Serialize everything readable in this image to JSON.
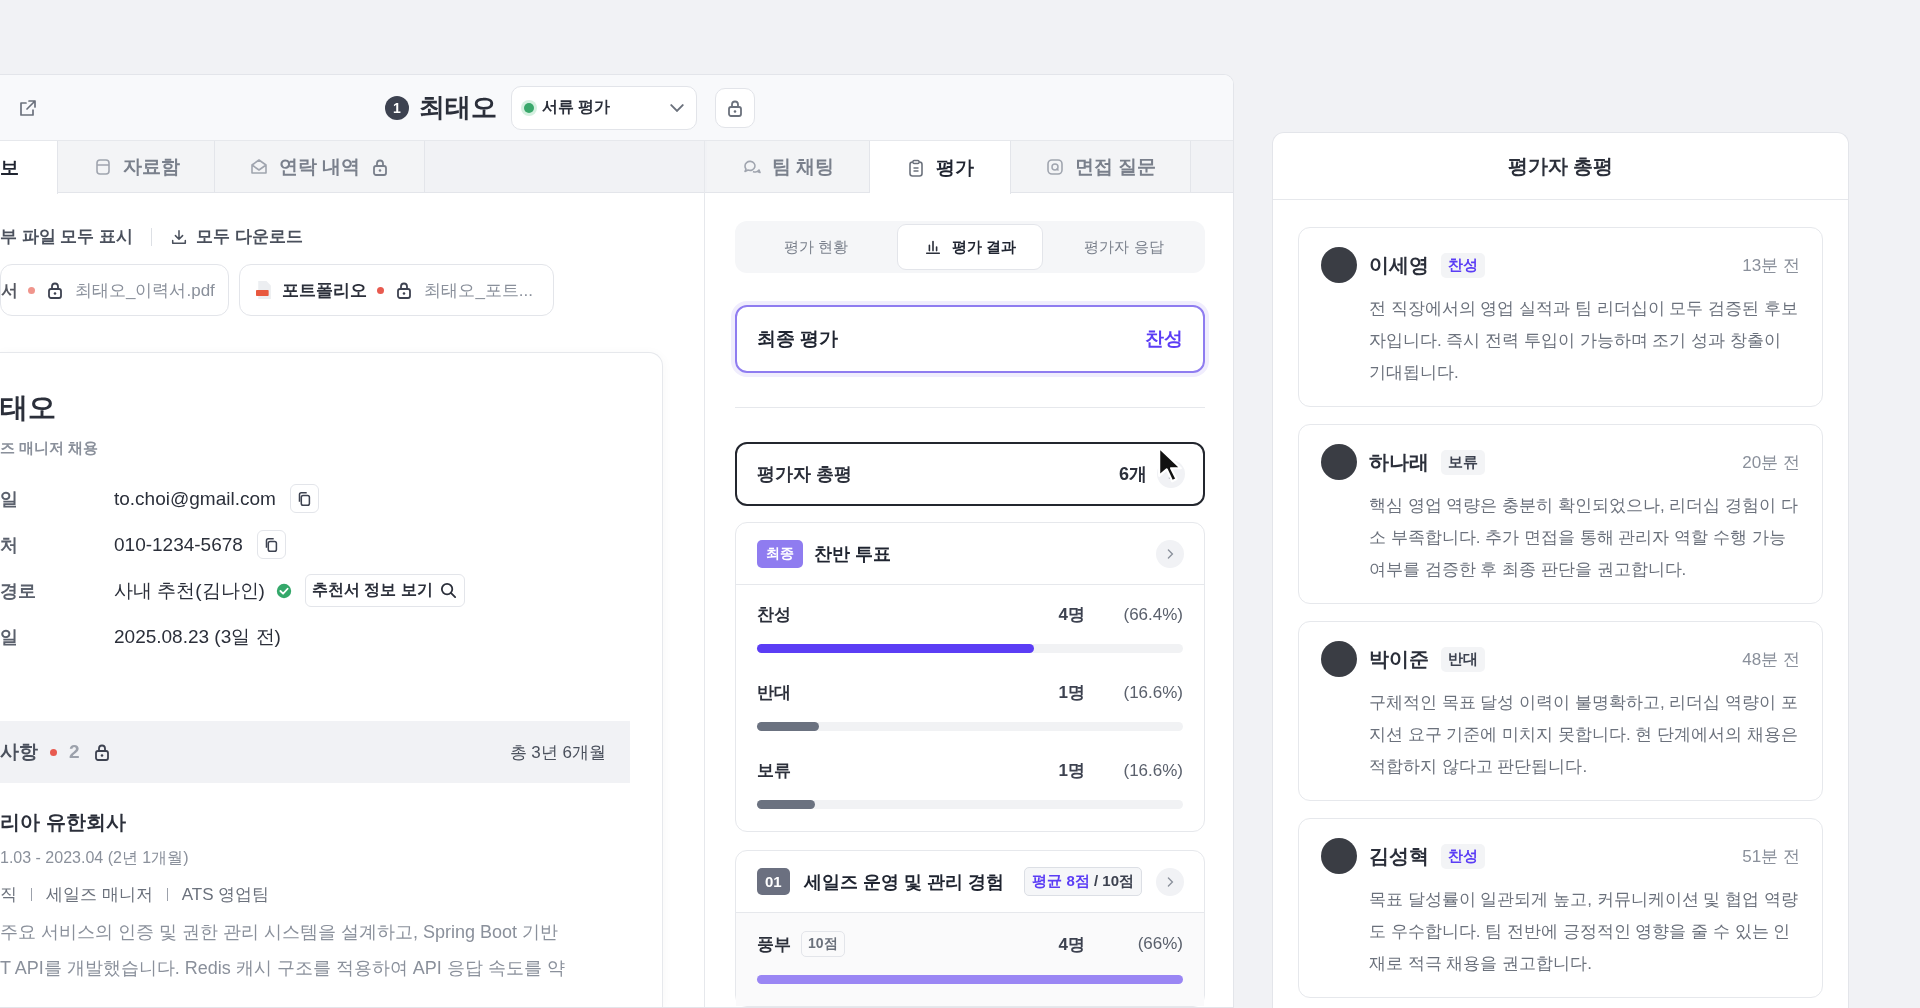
{
  "header": {
    "candidate_number": "1",
    "candidate_name": "최태오",
    "stage": "서류 평가",
    "locked": true
  },
  "left_tabs": [
    {
      "label": "보",
      "selected": true,
      "locked": false
    },
    {
      "label": "자료함",
      "selected": false,
      "locked": false
    },
    {
      "label": "연락 내역",
      "selected": false,
      "locked": true
    }
  ],
  "attachments": {
    "show_all": "부 파일 모두 표시",
    "download_all": "모두 다운로드",
    "files": [
      {
        "type_label": "서",
        "flagged": true,
        "locked": true,
        "file_name": "최태오_이력서.pdf"
      },
      {
        "type_label": "포트폴리오",
        "flagged": true,
        "locked": true,
        "file_name": "최태오_포트..."
      }
    ]
  },
  "profile": {
    "name": "태오",
    "position": "즈 매니저 채용",
    "fields": [
      {
        "label": "일",
        "value": "to.choi@gmail.com",
        "copyable": true,
        "verified": false
      },
      {
        "label": "처",
        "value": "010-1234-5678",
        "copyable": true,
        "verified": false
      },
      {
        "label": "경로",
        "value": "사내 추천(김나인)",
        "copyable": false,
        "verified": true,
        "action": "추천서 정보 보기"
      },
      {
        "label": "일",
        "value": "2025.08.23 (3일 전)",
        "copyable": false,
        "verified": false
      }
    ]
  },
  "career": {
    "title": "사항",
    "flagged": true,
    "count": "2",
    "locked": true,
    "total": "총 3년 6개월",
    "entries": [
      {
        "company": "리아 유한회사",
        "period": "1.03 - 2023.04 (2년 1개월)",
        "details": [
          "직",
          "세일즈 매니저",
          "ATS 영업팀"
        ],
        "description": [
          "주요 서비스의 인증 및 권한 관리 시스템을 설계하고, Spring Boot 기반",
          "T API를 개발했습니다. Redis 캐시 구조를 적용하여 API 응답 속도를 약"
        ]
      }
    ]
  },
  "right_tabs": [
    {
      "label": "팀 채팅",
      "selected": false
    },
    {
      "label": "평가",
      "selected": true
    },
    {
      "label": "면접 질문",
      "selected": false
    }
  ],
  "evaluation": {
    "segments": [
      {
        "label": "평가 현황",
        "selected": false
      },
      {
        "label": "평가 결과",
        "selected": true
      },
      {
        "label": "평가자 응답",
        "selected": false
      }
    ],
    "final": {
      "label": "최종 평가",
      "value": "찬성"
    },
    "summary": {
      "label": "평가자 총평",
      "count": "6개"
    },
    "vote": {
      "badge": "최종",
      "title": "찬반 투표",
      "options": [
        {
          "label": "찬성",
          "count": "4명",
          "percent": "(66.4%)",
          "level": 0.65,
          "color": "#5b3df5"
        },
        {
          "label": "반대",
          "count": "1명",
          "percent": "(16.6%)",
          "level": 0.145,
          "color": "#6b7280"
        },
        {
          "label": "보류",
          "count": "1명",
          "percent": "(16.6%)",
          "level": 0.137,
          "color": "#6b7280"
        }
      ]
    },
    "categories": [
      {
        "number": "01",
        "title": "세일즈 운영 및 관리 경험",
        "average": "평균 8점",
        "max": "/ 10점",
        "levels": [
          {
            "label": "풍부",
            "score": "10점",
            "count": "4명",
            "percent": "(66%)",
            "level": 1,
            "color": "#9a86f4"
          }
        ]
      }
    ]
  },
  "reviews": {
    "title": "평가자 총평",
    "items": [
      {
        "name": "이세영",
        "verdict": "찬성",
        "kind": "approve",
        "time": "13분 전",
        "comment": "전 직장에서의 영업 실적과 팀 리더십이 모두 검증된 후보자입니다. 즉시 전력 투입이 가능하며 조기 성과 창출이 기대됩니다."
      },
      {
        "name": "하나래",
        "verdict": "보류",
        "kind": "other",
        "time": "20분 전",
        "comment": "핵심 영업 역량은 충분히 확인되었으나, 리더십 경험이 다소 부족합니다. 추가 면접을 통해 관리자 역할 수행 가능 여부를 검증한 후 최종 판단을 권고합니다."
      },
      {
        "name": "박이준",
        "verdict": "반대",
        "kind": "other",
        "time": "48분 전",
        "comment": "구체적인 목표 달성 이력이 불명확하고, 리더십 역량이 포지션 요구 기준에 미치지 못합니다. 현 단계에서의 채용은 적합하지 않다고 판단됩니다."
      },
      {
        "name": "김성혁",
        "verdict": "찬성",
        "kind": "approve",
        "time": "51분 전",
        "comment": "목표 달성률이 일관되게 높고, 커뮤니케이션 및 협업 역량도 우수합니다. 팀 전반에 긍정적인 영향을 줄 수 있는 인재로 적극 채용을 권고합니다."
      }
    ]
  }
}
